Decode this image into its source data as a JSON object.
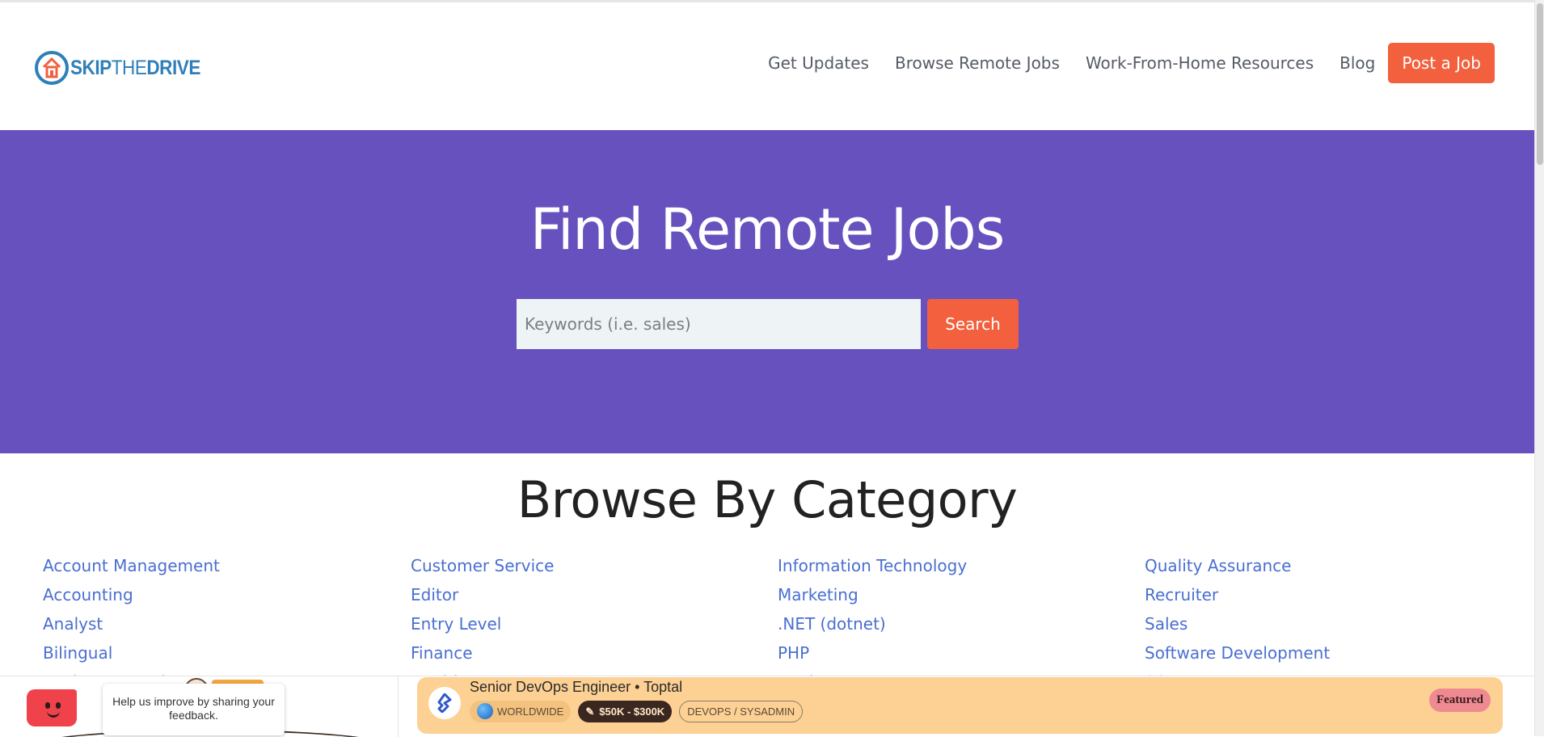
{
  "header": {
    "logo_text_skip": "SKIP",
    "logo_text_the": "THE",
    "logo_text_drive": "DRIVE",
    "nav": [
      {
        "label": "Get Updates"
      },
      {
        "label": "Browse Remote Jobs"
      },
      {
        "label": "Work-From-Home Resources"
      },
      {
        "label": "Blog"
      }
    ],
    "cta_label": "Post a Job"
  },
  "hero": {
    "title": "Find Remote Jobs",
    "search_placeholder": "Keywords (i.e. sales)",
    "search_button": "Search"
  },
  "categories": {
    "title": "Browse By Category",
    "columns": [
      [
        "Account Management",
        "Accounting",
        "Analyst",
        "Bilingual",
        "Business Development"
      ],
      [
        "Customer Service",
        "Editor",
        "Entry Level",
        "Finance",
        "Healthcare"
      ],
      [
        "Information Technology",
        "Marketing",
        ".NET (dotnet)",
        "PHP",
        "Product Management"
      ],
      [
        "Quality Assurance",
        "Recruiter",
        "Sales",
        "Software Development",
        "SQL"
      ]
    ]
  },
  "feedback": {
    "text": "Help us improve by sharing your feedback."
  },
  "featured_job": {
    "title": "Senior DevOps Engineer • Toptal",
    "location": "WORLDWIDE",
    "salary": "$50K - $300K",
    "category": "DEVOPS / SYSADMIN",
    "badge": "Featured"
  },
  "colors": {
    "hero_bg": "#6651be",
    "accent": "#f2603d",
    "link": "#4a6fd1",
    "job_card_bg": "#fdd093"
  }
}
